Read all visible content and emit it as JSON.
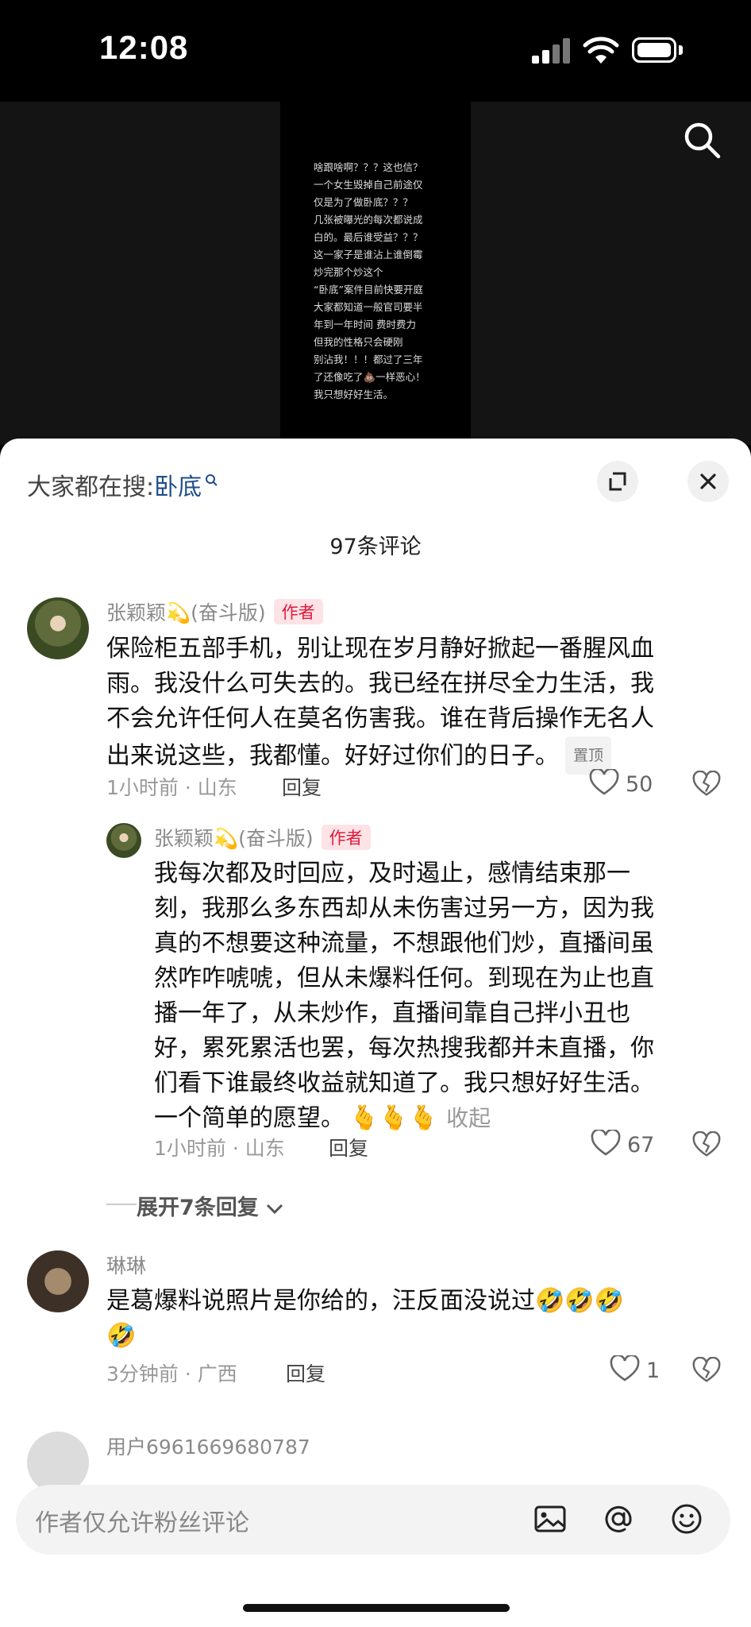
{
  "status_bar": {
    "time": "12:08"
  },
  "video": {
    "overlay_lines": [
      "啥跟啥啊？？？这也信？",
      "一个女生毁掉自己前途仅",
      "仅是为了做卧底？？？",
      "几张被曝光的每次都说成",
      "白的。最后谁受益？？？",
      "这一家子是谁沾上谁倒霉",
      "炒完那个炒这个",
      "“卧底”案件目前快要开庭",
      "大家都知道一般官司要半",
      "年到一年时间 费时费力",
      "但我的性格只会硬刚",
      "别沾我！！！都过了三年",
      "了还像吃了💩一样恶心！",
      "我只想好好生活。"
    ]
  },
  "sheet": {
    "search_prefix": "大家都在搜:",
    "search_keyword": "卧底",
    "comment_count": "97条评论"
  },
  "comments": [
    {
      "name": "张颖颖💫(奋斗版)",
      "author_tag": "作者",
      "lines": [
        "保险柜五部手机，别让现在岁月静好掀起一番腥风血",
        "雨。我没什么可失去的。我已经在拼尽全力生活，我",
        "不会允许任何人在莫名伤害我。谁在背后操作无名人",
        "出来说这些，我都懂。好好过你们的日子。"
      ],
      "pin_tag": "置顶",
      "meta": "1小时前 · 山东",
      "reply_label": "回复",
      "likes": "50"
    },
    {
      "name": "张颖颖💫(奋斗版)",
      "author_tag": "作者",
      "lines": [
        "我每次都及时回应，及时遏止，感情结束那一",
        "刻，我那么多东西却从未伤害过另一方，因为我",
        "真的不想要这种流量，不想跟他们炒，直播间虽",
        "然咋咋唬唬，但从未爆料任何。到现在为止也直",
        "播一年了，从未炒作，直播间靠自己拌小丑也",
        "好，累死累活也罢，每次热搜我都并未直播，你",
        "们看下谁最终收益就知道了。我只想好好生活。",
        "一个简单的愿望。"
      ],
      "emojis": "🫰🫰🫰",
      "collapse_label": "收起",
      "meta": "1小时前 · 山东",
      "reply_label": "回复",
      "likes": "67"
    },
    {
      "name": "琳琳",
      "lines": [
        "是葛爆料说照片是你给的，汪反面没说过🤣🤣🤣",
        "🤣"
      ],
      "meta": "3分钟前 · 广西",
      "reply_label": "回复",
      "likes": "1"
    },
    {
      "name": "用户6961669680787"
    }
  ],
  "expand_replies": "展开7条回复",
  "input": {
    "placeholder": "作者仅允许粉丝评论"
  }
}
